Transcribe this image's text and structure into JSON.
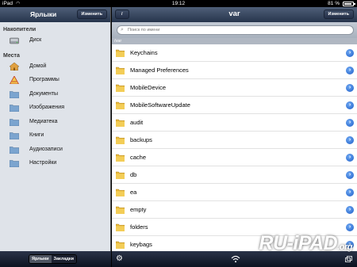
{
  "status_bar": {
    "carrier": "iPad",
    "time": "19:12",
    "battery": "81 %"
  },
  "sidebar": {
    "title": "Ярлыки",
    "edit_label": "Изменить",
    "sections": [
      {
        "title": "Накопители",
        "items": [
          {
            "label": "Диск",
            "icon": "disk-icon"
          }
        ]
      },
      {
        "title": "Места",
        "items": [
          {
            "label": "Домой",
            "icon": "home-icon"
          },
          {
            "label": "Программы",
            "icon": "applications-icon"
          },
          {
            "label": "Документы",
            "icon": "documents-folder-icon"
          },
          {
            "label": "Изображения",
            "icon": "pictures-folder-icon"
          },
          {
            "label": "Медиатека",
            "icon": "media-folder-icon"
          },
          {
            "label": "Книги",
            "icon": "books-folder-icon"
          },
          {
            "label": "Аудиозаписи",
            "icon": "audio-folder-icon"
          },
          {
            "label": "Настройки",
            "icon": "settings-folder-icon"
          }
        ]
      }
    ],
    "footer_tabs": {
      "shortcuts": "Ярлыки",
      "bookmarks": "Закладки"
    }
  },
  "main": {
    "back_label": "/",
    "title": "var",
    "edit_label": "Изменить",
    "search_placeholder": "Поиск по имени",
    "path": "/var",
    "items": [
      "Keychains",
      "Managed Preferences",
      "MobileDevice",
      "MobileSoftwareUpdate",
      "audit",
      "backups",
      "cache",
      "db",
      "ea",
      "empty",
      "folders",
      "keybags"
    ]
  },
  "watermark": {
    "text": "RU-iPAD",
    "suffix": ".org"
  },
  "colors": {
    "folder": "#e8b83a",
    "disclosure": "#2a6fd6",
    "bar": "#2f3d55"
  }
}
